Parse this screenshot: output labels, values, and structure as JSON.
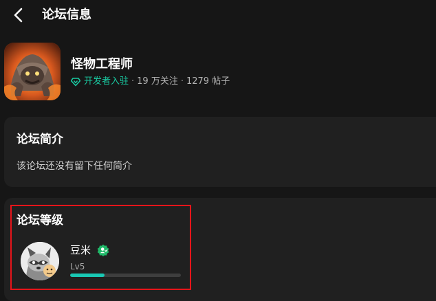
{
  "header": {
    "back_icon": "chevron-left-icon",
    "title": "论坛信息"
  },
  "forum": {
    "name": "怪物工程师",
    "developer_badge": "开发者入驻",
    "separator": "·",
    "followers": "19 万关注",
    "posts": "1279 帖子",
    "badge_color": "#19c8a0"
  },
  "intro": {
    "title": "论坛简介",
    "text": "该论坛还没有留下任何简介"
  },
  "level": {
    "title": "论坛等级",
    "user_name": "豆米",
    "badge_icon": "green-user-badge-icon",
    "level_text": "Lv5",
    "progress": 0.31,
    "progress_color": "#19c8b4"
  },
  "highlight_color": "#e8141a"
}
